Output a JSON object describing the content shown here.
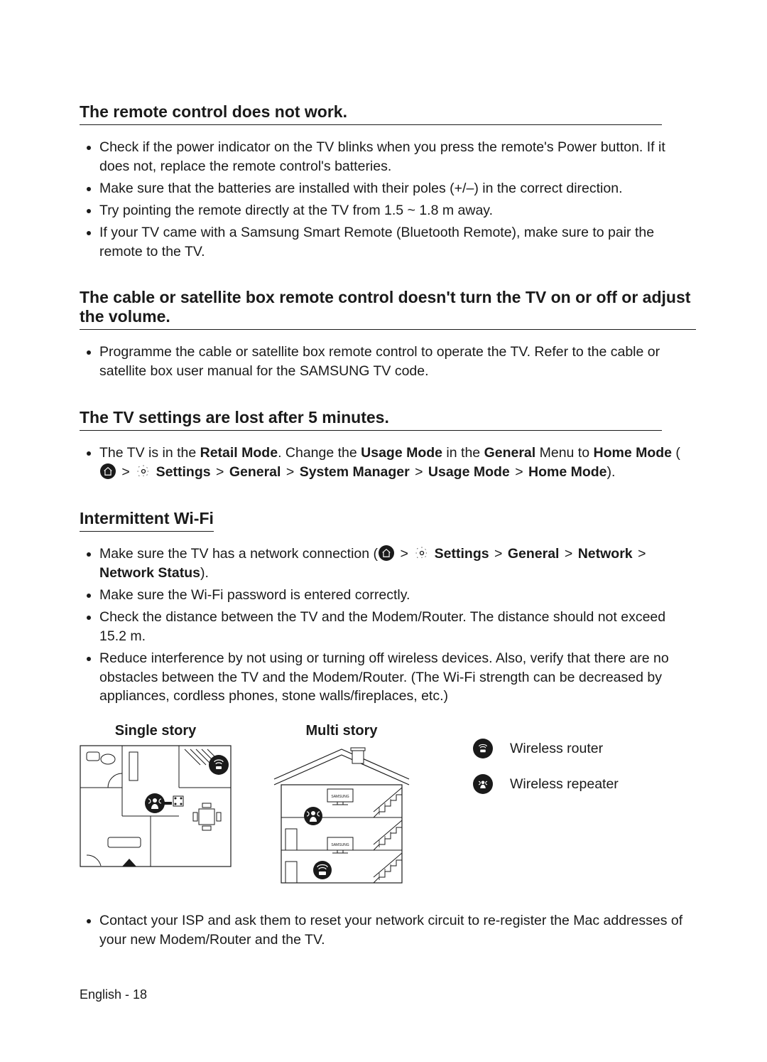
{
  "sections": {
    "remote": {
      "heading": "The remote control does not work.",
      "items": [
        "Check if the power indicator on the TV blinks when you press the remote's Power button. If it does not, replace the remote control's batteries.",
        "Make sure that the batteries are installed with their poles (+/–) in the correct direction.",
        "Try pointing the remote directly at the TV from 1.5 ~ 1.8 m away.",
        "If your TV came with a Samsung Smart Remote (Bluetooth Remote), make sure to pair the remote to the TV."
      ]
    },
    "cable": {
      "heading": "The cable or satellite box remote control doesn't turn the TV on or off or adjust the volume.",
      "items": [
        "Programme the cable or satellite box remote control to operate the TV. Refer to the cable or satellite box user manual for the SAMSUNG TV code."
      ]
    },
    "settings_lost": {
      "heading": "The TV settings are lost after 5 minutes.",
      "line_pre": "The TV is in the ",
      "retail": "Retail Mode",
      "line_mid1": ". Change the ",
      "usage_mode": "Usage Mode",
      "line_mid2": " in the ",
      "general": "General",
      "line_mid3": " Menu to ",
      "home_mode": "Home Mode",
      "line_open": " (",
      "path": {
        "settings": "Settings",
        "general": "General",
        "system_manager": "System Manager",
        "usage_mode": "Usage Mode",
        "home_mode": "Home Mode"
      },
      "line_close": ")."
    },
    "wifi": {
      "heading": "Intermittent Wi-Fi",
      "item1_pre": "Make sure the TV has a network connection (",
      "path": {
        "settings": "Settings",
        "general": "General",
        "network": "Network",
        "network_status": "Network Status"
      },
      "item1_post": ").",
      "item2": "Make sure the Wi-Fi password is entered correctly.",
      "item3": "Check the distance between the TV and the Modem/Router. The distance should not exceed 15.2 m.",
      "item4": "Reduce interference by not using or turning off wireless devices. Also, verify that there are no obstacles between the TV and the Modem/Router. (The Wi-Fi strength can be decreased by appliances, cordless phones, stone walls/fireplaces, etc.)",
      "item5": "Contact your ISP and ask them to reset your network circuit to re-register the Mac addresses of your new Modem/Router and the TV."
    }
  },
  "diagrams": {
    "single": "Single story",
    "multi": "Multi story",
    "samsung": "SAMSUNG"
  },
  "legend": {
    "router": "Wireless router",
    "repeater": "Wireless repeater"
  },
  "footer": {
    "lang": "English",
    "sep": " - ",
    "page": "18"
  },
  "gt": ">"
}
